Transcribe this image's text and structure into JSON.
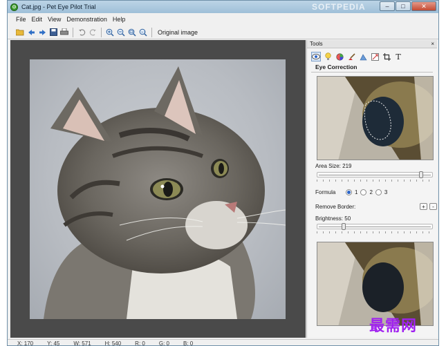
{
  "window": {
    "title": "Cat.jpg - Pet Eye Pilot Trial",
    "watermark_top": "SOFTPEDIA",
    "controls": [
      "minimize",
      "maximize",
      "close"
    ]
  },
  "menu": {
    "items": [
      "File",
      "Edit",
      "View",
      "Demonstration",
      "Help"
    ]
  },
  "toolbar": {
    "icons": [
      "open-folder-icon",
      "back-arrow-icon",
      "forward-arrow-icon",
      "save-icon",
      "print-icon",
      "undo-icon",
      "redo-icon",
      "zoom-in-icon",
      "zoom-out-icon",
      "zoom-fit-icon",
      "zoom-actual-icon"
    ],
    "original_image_label": "Original image"
  },
  "tools": {
    "panel_title": "Tools",
    "close_label": "×",
    "section_title": "Eye Correction",
    "area_size_label": "Area Size: 219",
    "area_size_value": 219,
    "area_size_fraction": 0.93,
    "formula_label": "Formula",
    "formula_options": [
      "1",
      "2",
      "3"
    ],
    "formula_selected": "1",
    "remove_border_label": "Remove Border:",
    "plus_label": "+",
    "minus_label": "-",
    "brightness_label": "Brightness: 50",
    "brightness_value": 50,
    "brightness_fraction": 0.22
  },
  "statusbar": {
    "items": [
      "X: 170",
      "Y: 45",
      "W: 571",
      "H: 540",
      "R: 0",
      "G: 0",
      "B: 0"
    ]
  },
  "watermark_bottom": "最需网",
  "colors": {
    "canvas_bg": "#4a4a4a",
    "accent": "#2a64c8",
    "watermark": "#a020f0"
  }
}
